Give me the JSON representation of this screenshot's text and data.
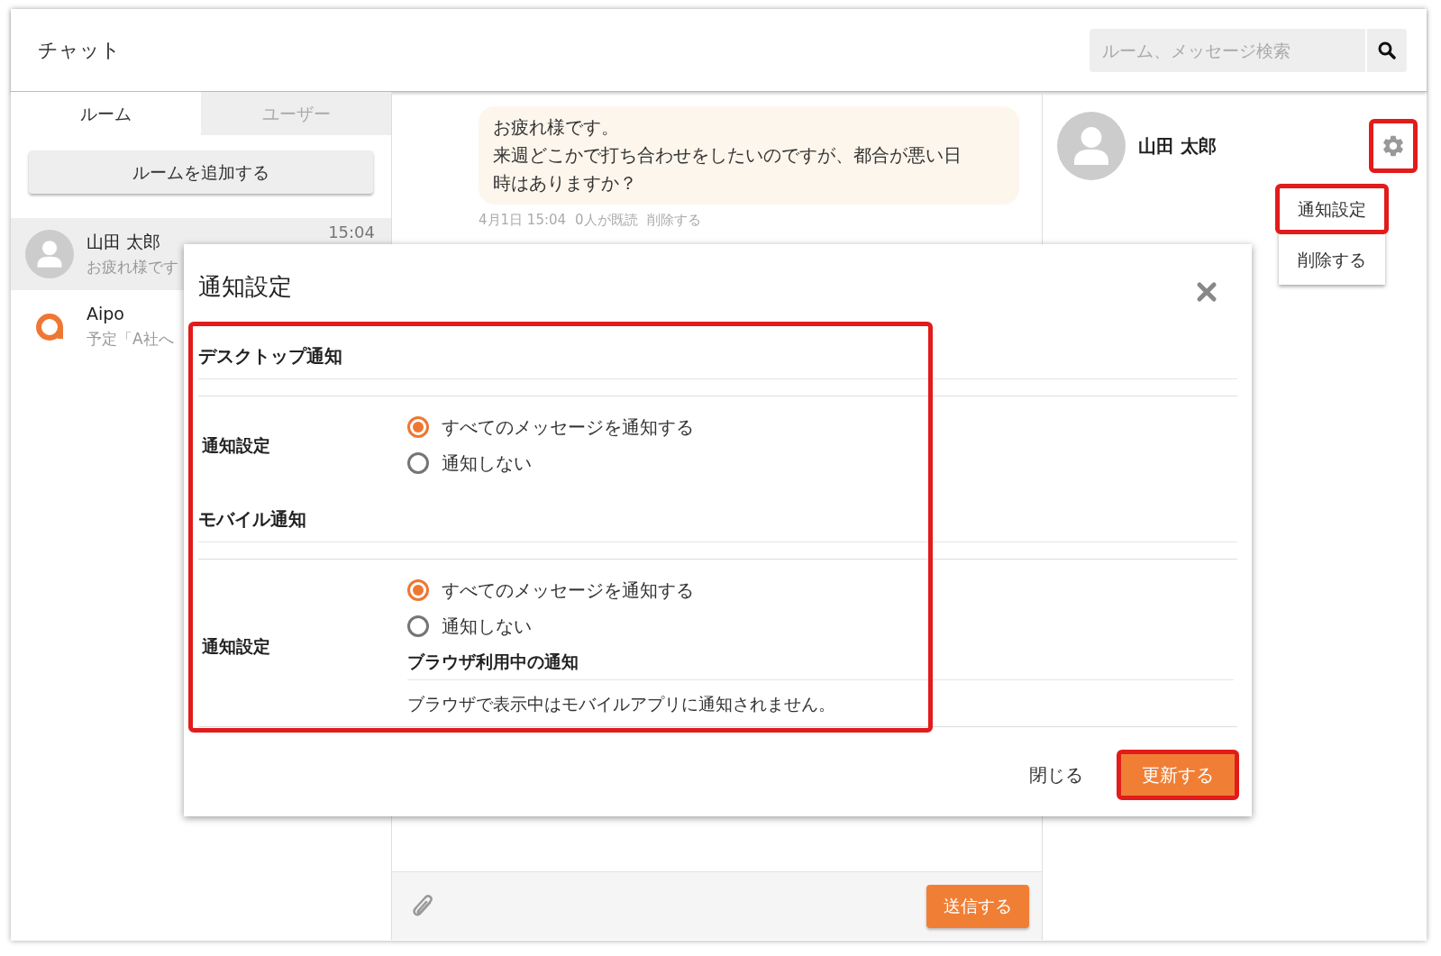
{
  "header": {
    "title": "チャット",
    "search": {
      "placeholder": "ルーム、メッセージ検索"
    }
  },
  "sidebar": {
    "tabs": [
      {
        "label": "ルーム",
        "selected": true
      },
      {
        "label": "ユーザー",
        "selected": false
      }
    ],
    "add_button": "ルームを追加する",
    "rooms": [
      {
        "name": "山田 太郎",
        "preview": "お疲れ様です",
        "time": "15:04",
        "selected": true,
        "kind": "person"
      },
      {
        "name": "Aipo",
        "preview": "予定「A社へ",
        "selected": false,
        "kind": "logo"
      }
    ]
  },
  "messages": [
    {
      "lines": [
        "お疲れ様です。",
        "来週どこかで打ち合わせをしたいのですが、都合が悪い日時はありますか？"
      ],
      "date": "4月1日 15:04",
      "read": "0人が既読",
      "delete_link": "削除する"
    }
  ],
  "composer": {
    "send_button": "送信する"
  },
  "profile": {
    "name": "山田 太郎",
    "gear_highlighted": true,
    "menu": [
      {
        "label": "通知設定",
        "highlighted": true
      },
      {
        "label": "削除する",
        "highlighted": false
      }
    ]
  },
  "dialog": {
    "title": "通知設定",
    "content_highlighted": true,
    "sections": [
      {
        "heading": "デスクトップ通知",
        "label": "通知設定",
        "options": [
          {
            "label": "すべてのメッセージを通知する",
            "selected": true
          },
          {
            "label": "通知しない",
            "selected": false
          }
        ]
      },
      {
        "heading": "モバイル通知",
        "label": "通知設定",
        "options": [
          {
            "label": "すべてのメッセージを通知する",
            "selected": true
          },
          {
            "label": "通知しない",
            "selected": false
          }
        ],
        "subheading": "ブラウザ利用中の通知",
        "note": "ブラウザで表示中はモバイルアプリに通知されません。"
      }
    ],
    "buttons": [
      {
        "label": "閉じる",
        "kind": "text",
        "highlighted": false
      },
      {
        "label": "更新する",
        "kind": "primary",
        "highlighted": true
      }
    ]
  }
}
